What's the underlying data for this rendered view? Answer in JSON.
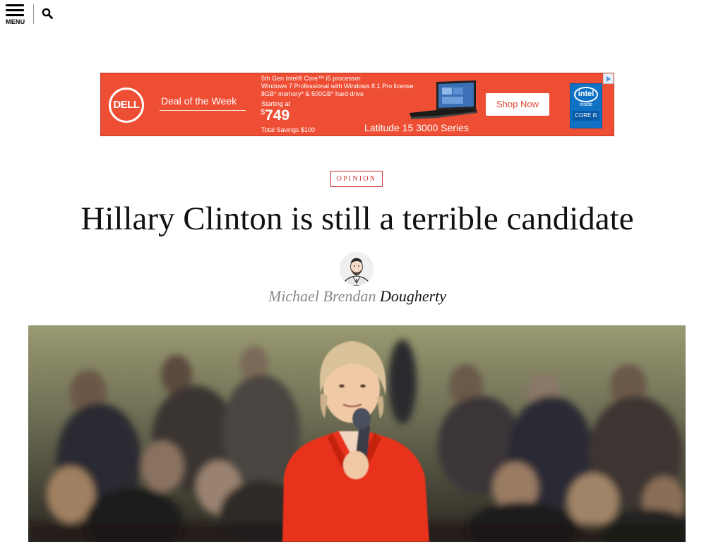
{
  "nav": {
    "menu_label": "MENU",
    "menu_icon": "hamburger-icon",
    "search_icon": "search-icon"
  },
  "ad": {
    "brand": "DELL",
    "deal": "Deal of the Week",
    "spec_line_1": "5th Gen Intel® Core™ i5 processor",
    "spec_line_2": "Windows 7 Professional with Windows 8.1 Pro license",
    "spec_line_3": "8GB* memory* & 500GB* hard drive",
    "starting_at": "Starting at",
    "price_symbol": "$",
    "price": "749",
    "savings": "Total Savings $100",
    "series": "Latitude 15 3000 Series",
    "cta": "Shop Now",
    "intel_word": "intel",
    "intel_inside": "inside",
    "intel_core": "CORE i5",
    "colors": {
      "background": "#ee4e34",
      "cta_text": "#e0492f",
      "intel_blue": "#1072c5"
    }
  },
  "article": {
    "category": "OPINION",
    "headline": "Hillary Clinton is still a terrible candidate",
    "author_first": "Michael Brendan",
    "author_last": "Dougherty",
    "colors": {
      "category": "#c9302c"
    }
  }
}
